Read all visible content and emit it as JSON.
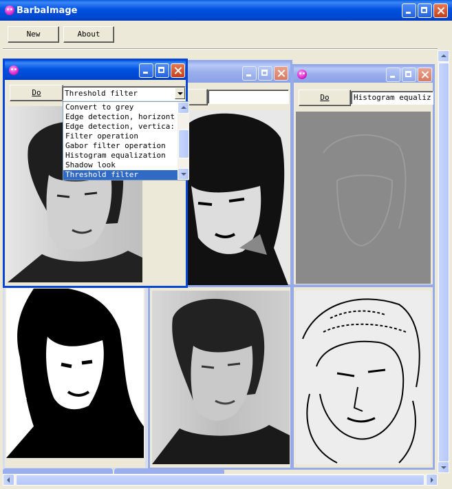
{
  "app": {
    "title": "BarbaImage",
    "new_label": "New",
    "about_label": "About"
  },
  "windows": [
    {
      "id": "w1",
      "do_label": "Do",
      "filter_value": "Threshold filter",
      "dropdown_open": true
    },
    {
      "id": "w2",
      "do_label": "",
      "filter_value": ""
    },
    {
      "id": "w3",
      "do_label": "Do",
      "filter_value": "Histogram equaliz"
    }
  ],
  "dropdown": {
    "options": [
      "Convert to grey",
      "Edge detection, horizont",
      "Edge detection, vertica:",
      "Filter operation",
      "Gabor filter operation",
      "Histogram equalization",
      "Shadow look",
      "Threshold filter"
    ],
    "selected_index": 7
  },
  "colors": {
    "titlebar_active": "#0052E0",
    "selection": "#316AC5",
    "workspace": "#ECE9D8"
  },
  "icons": [
    "app-icon",
    "minimize-icon",
    "maximize-icon",
    "close-icon",
    "chevron-down-icon",
    "chevron-up-icon",
    "chevron-left-icon",
    "chevron-right-icon"
  ]
}
